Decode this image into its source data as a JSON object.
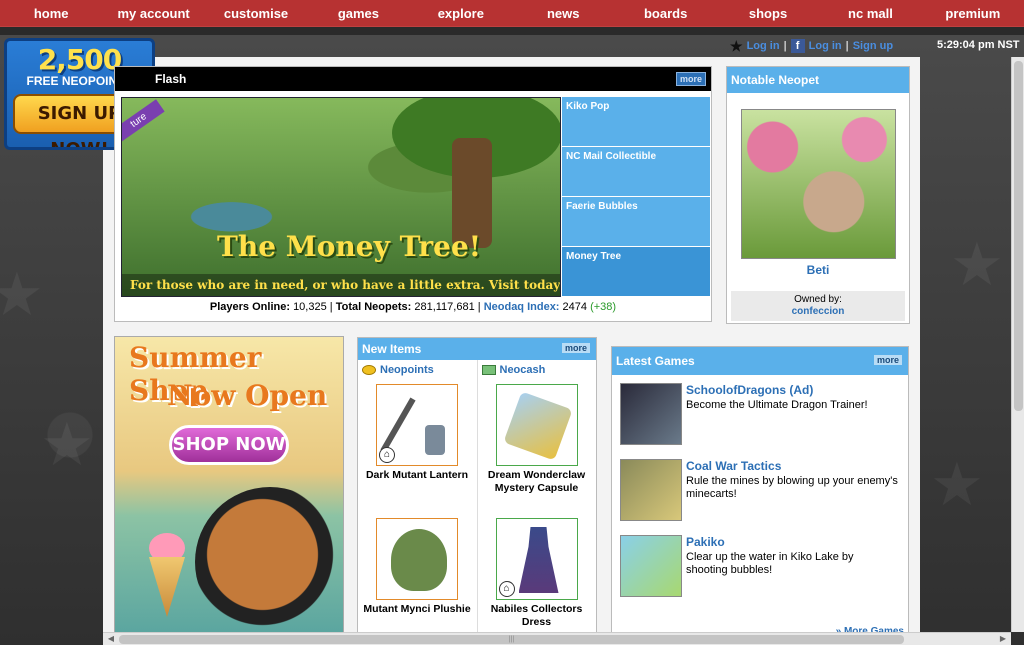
{
  "nav": {
    "items": [
      "home",
      "my account",
      "customise",
      "games",
      "explore",
      "news",
      "boards",
      "shops",
      "nc mall",
      "premium"
    ]
  },
  "status": {
    "login_label": "Log in",
    "fb_login_label": "Log in",
    "signup_label": "Sign up",
    "time": "5:29:04 pm NST"
  },
  "signup_badge": {
    "amount": "2,500",
    "subtitle": "FREE NEOPOINTS",
    "button": "SIGN UP NOW!"
  },
  "flash": {
    "title": "Flash",
    "more": "more",
    "feature_title": "The Money Tree!",
    "feature_caption": "For those who are in need, or who have a little extra. Visit today!",
    "ribbon": "ture",
    "list": [
      {
        "label": "Kiko Pop"
      },
      {
        "label": "NC Mail Collectible"
      },
      {
        "label": "Faerie Bubbles"
      },
      {
        "label": "Money Tree"
      }
    ],
    "stats": {
      "players_label": "Players Online:",
      "players_value": "10,325",
      "total_label": "Total Neopets:",
      "total_value": "281,117,681",
      "neodaq_label": "Neodaq Index:",
      "neodaq_value": "2474",
      "neodaq_change": "(+38)"
    }
  },
  "notable": {
    "title": "Notable Neopet",
    "pet_name": "Beti",
    "owned_by_label": "Owned by:",
    "owner": "confeccion"
  },
  "summer": {
    "line1": "Summer Shop",
    "line2": "Now Open",
    "button": "SHOP NOW"
  },
  "new_items": {
    "title": "New Items",
    "more": "more",
    "col1_title": "Neopoints",
    "col2_title": "Neocash",
    "items": [
      {
        "name": "Dark Mutant Lantern"
      },
      {
        "name": "Dream Wonderclaw Mystery Capsule"
      },
      {
        "name": "Mutant Mynci Plushie"
      },
      {
        "name": "Nabiles Collectors Dress"
      }
    ]
  },
  "latest_games": {
    "title": "Latest Games",
    "more": "more",
    "games": [
      {
        "title": "SchoolofDragons (Ad)",
        "desc": "Become the Ultimate Dragon Trainer!"
      },
      {
        "title": "Coal War Tactics",
        "desc": "Rule the mines by blowing up your enemy's minecarts!"
      },
      {
        "title": "Pakiko",
        "desc": "Clear up the water in Kiko Lake by shooting bubbles!"
      }
    ],
    "more_games": "» More Games"
  }
}
